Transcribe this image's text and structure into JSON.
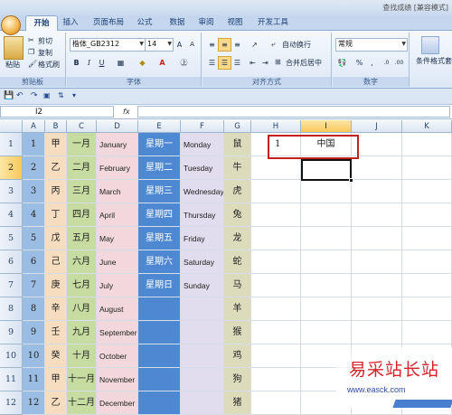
{
  "window": {
    "title": "查找成绩 [兼容模式]"
  },
  "tabs": [
    {
      "label": "开始",
      "active": true
    },
    {
      "label": "插入"
    },
    {
      "label": "页面布局"
    },
    {
      "label": "公式"
    },
    {
      "label": "数据"
    },
    {
      "label": "审阅"
    },
    {
      "label": "视图"
    },
    {
      "label": "开发工具"
    }
  ],
  "ribbon": {
    "clipboard": {
      "label": "剪贴板",
      "paste": "粘贴",
      "cut": "剪切",
      "copy": "复制",
      "format_painter": "格式刷"
    },
    "font": {
      "label": "字体",
      "name": "楷体_GB2312",
      "size": "14"
    },
    "alignment": {
      "label": "对齐方式",
      "wrap_text": "自动换行",
      "merge_center": "合并后居中"
    },
    "number": {
      "label": "数字",
      "format": "常规",
      "percent": "%"
    },
    "styles": {
      "conditional_format": "条件格式",
      "table_style_partial": "套"
    }
  },
  "formula_bar": {
    "name_box": "I2",
    "fx": "fx",
    "value": ""
  },
  "columns": [
    "A",
    "B",
    "C",
    "D",
    "E",
    "F",
    "G",
    "H",
    "I",
    "J",
    "K"
  ],
  "rows": [
    {
      "n": "1",
      "b": "甲",
      "c": "一月",
      "d": "January",
      "e": "星期一",
      "f": "Monday",
      "g": "鼠",
      "h": "1",
      "i": "中国"
    },
    {
      "n": "2",
      "b": "乙",
      "c": "二月",
      "d": "February",
      "e": "星期二",
      "f": "Tuesday",
      "g": "牛",
      "h": "",
      "i": ""
    },
    {
      "n": "3",
      "b": "丙",
      "c": "三月",
      "d": "March",
      "e": "星期三",
      "f": "Wednesday",
      "g": "虎",
      "h": "",
      "i": ""
    },
    {
      "n": "4",
      "b": "丁",
      "c": "四月",
      "d": "April",
      "e": "星期四",
      "f": "Thursday",
      "g": "兔",
      "h": "",
      "i": ""
    },
    {
      "n": "5",
      "b": "戊",
      "c": "五月",
      "d": "May",
      "e": "星期五",
      "f": "Friday",
      "g": "龙",
      "h": "",
      "i": ""
    },
    {
      "n": "6",
      "b": "己",
      "c": "六月",
      "d": "June",
      "e": "星期六",
      "f": "Saturday",
      "g": "蛇",
      "h": "",
      "i": ""
    },
    {
      "n": "7",
      "b": "庚",
      "c": "七月",
      "d": "July",
      "e": "星期日",
      "f": "Sunday",
      "g": "马",
      "h": "",
      "i": ""
    },
    {
      "n": "8",
      "b": "辛",
      "c": "八月",
      "d": "August",
      "e": "",
      "f": "",
      "g": "羊",
      "h": "",
      "i": ""
    },
    {
      "n": "9",
      "b": "壬",
      "c": "九月",
      "d": "September",
      "e": "",
      "f": "",
      "g": "猴",
      "h": "",
      "i": ""
    },
    {
      "n": "10",
      "b": "癸",
      "c": "十月",
      "d": "October",
      "e": "",
      "f": "",
      "g": "鸡",
      "h": "",
      "i": ""
    },
    {
      "n": "11",
      "b": "甲",
      "c": "十一月",
      "d": "November",
      "e": "",
      "f": "",
      "g": "狗",
      "h": "",
      "i": ""
    },
    {
      "n": "12",
      "b": "乙",
      "c": "十二月",
      "d": "December",
      "e": "",
      "f": "",
      "g": "猪",
      "h": "",
      "i": ""
    }
  ],
  "colors": {
    "col_a": "#9cbde3",
    "col_b": "#f6ddc0",
    "col_c": "#c7dca0",
    "col_d": "#f2d8dc",
    "col_e": "#4f88d2",
    "col_f": "#e1dcee",
    "col_g": "#dcdcbc",
    "highlight_box": "#c4201a"
  },
  "watermark": {
    "title": "易采站长站",
    "url": "www.easck.com"
  }
}
